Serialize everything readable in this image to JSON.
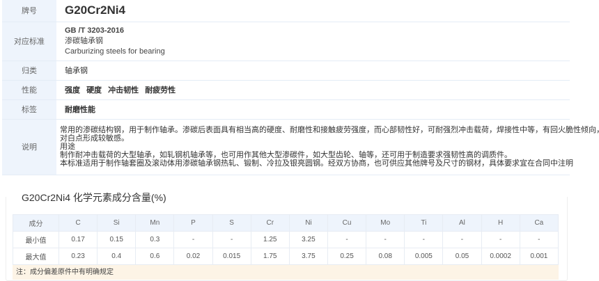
{
  "labels": {
    "grade": "牌号",
    "standard": "对应标准",
    "category": "归类",
    "performance": "性能",
    "tags": "标签",
    "description": "说明"
  },
  "grade": "G20Cr2Ni4",
  "standard": {
    "code": "GB /T 3203-2016",
    "name_cn": "渗碳轴承钢",
    "name_en": "Carburizing steels for bearing"
  },
  "category": "轴承钢",
  "performance": [
    "强度",
    "硬度",
    "冲击韧性",
    "耐疲劳性"
  ],
  "tags": [
    "耐磨性能"
  ],
  "description": [
    "常用的渗碳结构钢，用于制作轴承。渗碳后表面具有相当高的硬度、耐磨性和接触疲劳强度，而心部韧性好，可耐强烈冲击载荷，焊接性中等，有回火脆性倾向，",
    "对白点形成较敏感。",
    "用途",
    "制作耐冲击载荷的大型轴承，如轧钢机轴承等，也可用作其他大型渗碳件，如大型齿轮、轴等，还可用于制造要求强韧性高的调质件。",
    "本标准适用于制作轴套圈及滚动体用渗碳轴承钢热轧、锻制、冷拉及银亮圆钢。经双方协商，也可供应其他牌号及尺寸的钢材，具体要求宜在合同中注明"
  ],
  "composition": {
    "title": "G20Cr2Ni4 化学元素成分含量(%)",
    "header_label": "成分",
    "elements": [
      "C",
      "Si",
      "Mn",
      "P",
      "S",
      "Cr",
      "Ni",
      "Cu",
      "Mo",
      "Ti",
      "Al",
      "H",
      "Ca"
    ],
    "rows": [
      {
        "label": "最小值",
        "values": [
          "0.17",
          "0.15",
          "0.3",
          "-",
          "-",
          "1.25",
          "3.25",
          "-",
          "-",
          "-",
          "-",
          "-",
          "-"
        ]
      },
      {
        "label": "最大值",
        "values": [
          "0.23",
          "0.4",
          "0.6",
          "0.02",
          "0.015",
          "1.75",
          "3.75",
          "0.25",
          "0.08",
          "0.005",
          "0.05",
          "0.0002",
          "0.001"
        ]
      }
    ],
    "note": "注：成分偏差原件中有明确规定"
  }
}
